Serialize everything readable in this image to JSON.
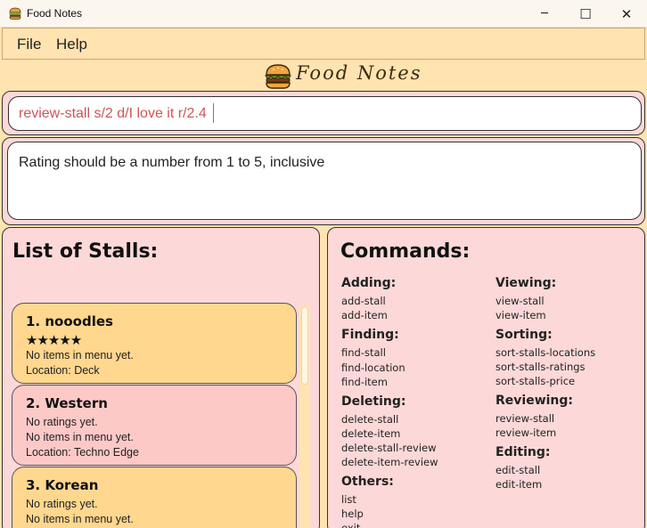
{
  "window": {
    "title": "Food Notes",
    "minimize_glyph": "─",
    "maximize_glyph": "☐",
    "close_glyph": "✕"
  },
  "menu": {
    "file": "File",
    "help": "Help"
  },
  "logo": {
    "text": "Food Notes",
    "icon": "burger-icon"
  },
  "command_box": {
    "value": "review-stall s/2 d/I love it r/2.4"
  },
  "result_display": {
    "text": "Rating should be a number from 1 to 5, inclusive"
  },
  "stalls_panel": {
    "title": "List of Stalls:",
    "stalls": [
      {
        "name": "1.  nooodles",
        "rating_stars": "★★★★★",
        "menu": "No items in menu yet.",
        "location": "Location: Deck",
        "color": "#ffd78e"
      },
      {
        "name": "2.  Western",
        "rating": "No ratings yet.",
        "menu": "No items in menu yet.",
        "location": "Location: Techno Edge",
        "color": "#fcc9c7"
      },
      {
        "name": "3.  Korean",
        "rating": "No ratings yet.",
        "menu": "No items in menu yet.",
        "color": "#ffd78e"
      }
    ]
  },
  "commands_panel": {
    "title": "Commands:",
    "left": [
      {
        "heading": "Adding:",
        "items": [
          "add-stall",
          "add-item"
        ]
      },
      {
        "heading": "Finding:",
        "items": [
          "find-stall",
          "find-location",
          "find-item"
        ]
      },
      {
        "heading": "Deleting:",
        "items": [
          "delete-stall",
          "delete-item",
          "delete-stall-review",
          "delete-item-review"
        ]
      },
      {
        "heading": "Others:",
        "items": [
          "list",
          "help",
          "exit"
        ]
      }
    ],
    "right": [
      {
        "heading": "Viewing:",
        "items": [
          "view-stall",
          "view-item"
        ]
      },
      {
        "heading": "Sorting:",
        "items": [
          "sort-stalls-locations",
          "sort-stalls-ratings",
          "sort-stalls-price"
        ]
      },
      {
        "heading": "Reviewing:",
        "items": [
          "review-stall",
          "review-item"
        ]
      },
      {
        "heading": "Editing:",
        "items": [
          "edit-stall",
          "edit-item"
        ]
      }
    ]
  },
  "colors": {
    "background": "#ffe3b0",
    "panel": "#fdd8d8",
    "card_yellow": "#ffd78e",
    "card_pink": "#fcc9c7",
    "command_text": "#cc5555"
  }
}
